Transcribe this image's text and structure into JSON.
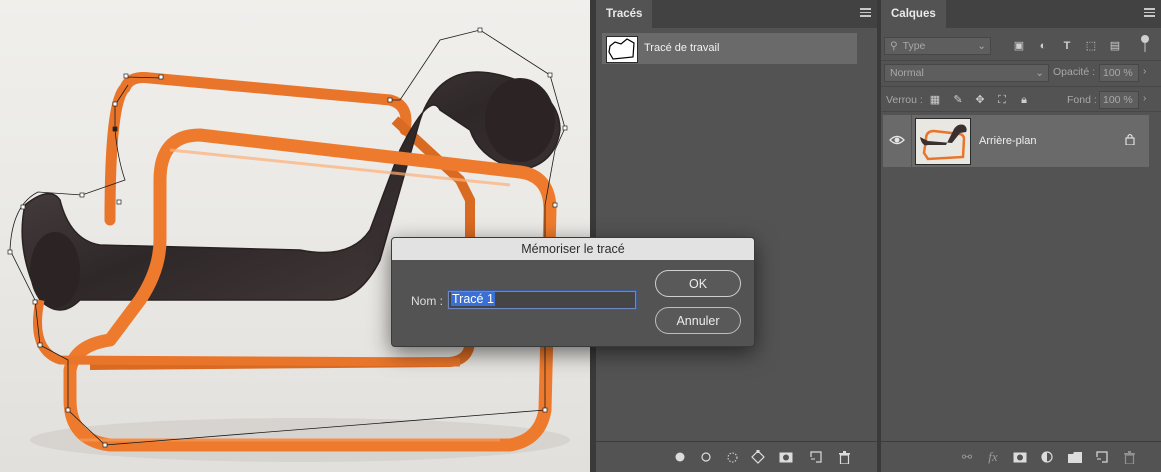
{
  "paths_panel": {
    "tab_label": "Tracés",
    "items": [
      {
        "label": "Tracé de travail"
      }
    ],
    "bottom_icons": [
      "fill-path-icon",
      "stroke-path-icon",
      "load-selection-icon",
      "make-work-path-icon",
      "add-mask-icon",
      "new-path-icon",
      "delete-path-icon"
    ]
  },
  "layers_panel": {
    "tab_label": "Calques",
    "filter_type": "Type",
    "blend_mode": "Normal",
    "opacity_label": "Opacité :",
    "opacity_value": "100 %",
    "lock_label": "Verrou :",
    "fill_label": "Fond :",
    "fill_value": "100 %",
    "layers": [
      {
        "name": "Arrière-plan",
        "visible": true,
        "locked": true
      }
    ],
    "bottom_icons": [
      "link-icon",
      "fx-icon",
      "mask-icon",
      "adjustment-icon",
      "group-folder-icon",
      "new-layer-icon",
      "trash-icon"
    ]
  },
  "dialog": {
    "title": "Mémoriser le tracé",
    "name_label": "Nom :",
    "name_value": "Tracé 1",
    "ok_label": "OK",
    "cancel_label": "Annuler"
  },
  "icons": {
    "fx_text": "fx",
    "type_layer_glyph": "T"
  },
  "colors": {
    "accent_selection": "#3a6fd6",
    "panel_bg": "#535353",
    "chair_orange": "#e8752a",
    "chair_dark": "#3a3030"
  }
}
